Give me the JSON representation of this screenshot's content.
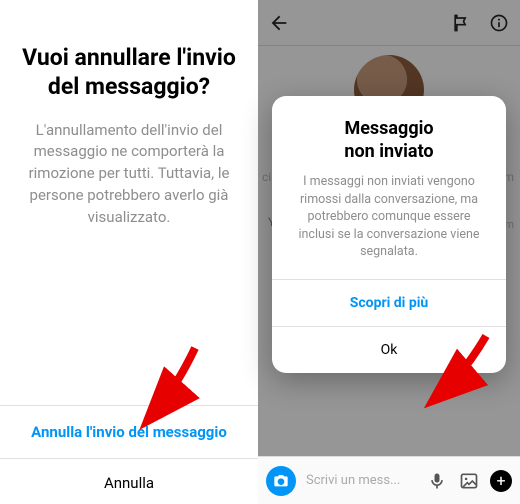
{
  "left_dialog": {
    "title": "Vuoi annullare l'invio del messaggio?",
    "body": "L'annullamento dell'invio del messaggio ne comporterà la rimozione per tutti. Tuttavia, le persone potrebbero averlo già visualizzato.",
    "primary_action": "Annulla l'invio del messaggio",
    "secondary_action": "Annulla"
  },
  "right_screen": {
    "name_fragment_left": "cin",
    "name_fragment_right": "am",
    "you_label": "You",
    "ts_fragment": "am",
    "composer_placeholder": "Scrivi un mess..."
  },
  "right_dialog": {
    "title": "Messaggio\nnon inviato",
    "body": "I messaggi non inviati vengono rimossi dalla conversazione, ma potrebbero comunque essere inclusi se la conversazione viene segnalata.",
    "learn_more": "Scopri di più",
    "ok": "Ok"
  },
  "colors": {
    "link": "#0095f6",
    "muted": "#8e8e8e"
  }
}
